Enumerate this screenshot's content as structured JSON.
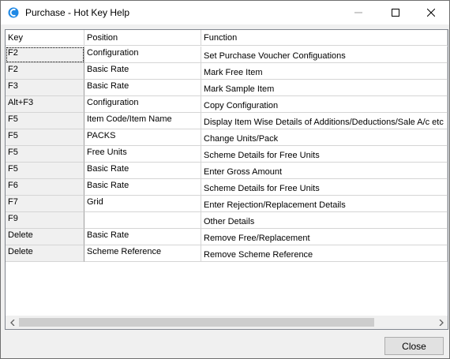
{
  "window": {
    "title": "Purchase - Hot Key Help",
    "controls": {
      "minimize_icon": "minimize-icon",
      "maximize_icon": "maximize-icon",
      "close_icon": "close-icon"
    }
  },
  "table": {
    "columns": [
      "Key",
      "Position",
      "Function"
    ],
    "rows": [
      {
        "key": "F2",
        "position": "Configuration",
        "function": "Set Purchase Voucher Configuations"
      },
      {
        "key": "F2",
        "position": "Basic Rate",
        "function": "Mark Free Item"
      },
      {
        "key": "F3",
        "position": "Basic Rate",
        "function": "Mark Sample Item"
      },
      {
        "key": "Alt+F3",
        "position": "Configuration",
        "function": "Copy Configuration"
      },
      {
        "key": "F5",
        "position": "Item Code/Item Name",
        "function": "Display Item Wise Details of Additions/Deductions/Sale A/c etc"
      },
      {
        "key": "F5",
        "position": "PACKS",
        "function": "Change Units/Pack"
      },
      {
        "key": "F5",
        "position": "Free Units",
        "function": "Scheme Details for Free Units"
      },
      {
        "key": "F5",
        "position": "Basic Rate",
        "function": "Enter Gross Amount"
      },
      {
        "key": "F6",
        "position": "Basic Rate",
        "function": "Scheme Details for Free Units"
      },
      {
        "key": "F7",
        "position": "Grid",
        "function": "Enter Rejection/Replacement Details"
      },
      {
        "key": "F9",
        "position": "",
        "function": "Other Details"
      },
      {
        "key": "Delete",
        "position": "Basic Rate",
        "function": "Remove Free/Replacement"
      },
      {
        "key": "Delete",
        "position": "Scheme Reference",
        "function": "Remove Scheme Reference"
      }
    ]
  },
  "footer": {
    "close_label": "Close"
  }
}
